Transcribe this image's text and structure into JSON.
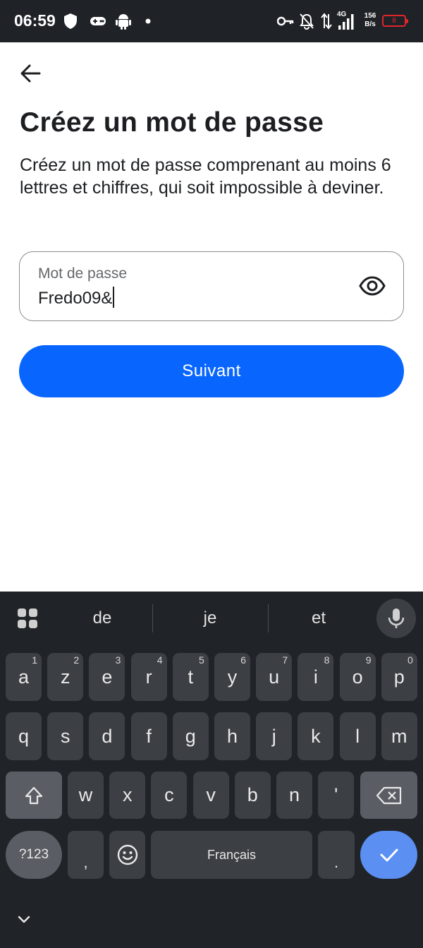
{
  "status_bar": {
    "time": "06:59",
    "network": "4G",
    "speed_value": "156",
    "speed_unit": "B/s",
    "battery": "8",
    "icons": [
      "shield-icon",
      "gamepad-icon",
      "android-icon",
      "dot-icon",
      "vpn-key-icon",
      "bell-off-icon",
      "data-arrows-icon",
      "signal-icon",
      "battery-icon"
    ]
  },
  "header": {
    "back_icon": "arrow-left-icon"
  },
  "page": {
    "title": "Créez un mot de passe",
    "description": "Créez un mot de passe comprenant au moins 6 lettres et chiffres, qui soit impossible à deviner."
  },
  "password_field": {
    "label": "Mot de passe",
    "value": "Fredo09&",
    "toggle_icon": "eye-icon"
  },
  "next_button": {
    "label": "Suivant"
  },
  "keyboard": {
    "suggestions": [
      "de",
      "je",
      "et"
    ],
    "row1": [
      {
        "key": "a",
        "hint": "1"
      },
      {
        "key": "z",
        "hint": "2"
      },
      {
        "key": "e",
        "hint": "3"
      },
      {
        "key": "r",
        "hint": "4"
      },
      {
        "key": "t",
        "hint": "5"
      },
      {
        "key": "y",
        "hint": "6"
      },
      {
        "key": "u",
        "hint": "7"
      },
      {
        "key": "i",
        "hint": "8"
      },
      {
        "key": "o",
        "hint": "9"
      },
      {
        "key": "p",
        "hint": "0"
      }
    ],
    "row2": [
      "q",
      "s",
      "d",
      "f",
      "g",
      "h",
      "j",
      "k",
      "l",
      "m"
    ],
    "row3": [
      "w",
      "x",
      "c",
      "v",
      "b",
      "n",
      "'"
    ],
    "symbols_label": "?123",
    "comma": ",",
    "space_label": "Français",
    "period": ".",
    "accent_color": "#5b8ff2"
  },
  "colors": {
    "primary_button": "#0866ff",
    "text": "#1c1e21",
    "keyboard_bg": "#202327"
  }
}
